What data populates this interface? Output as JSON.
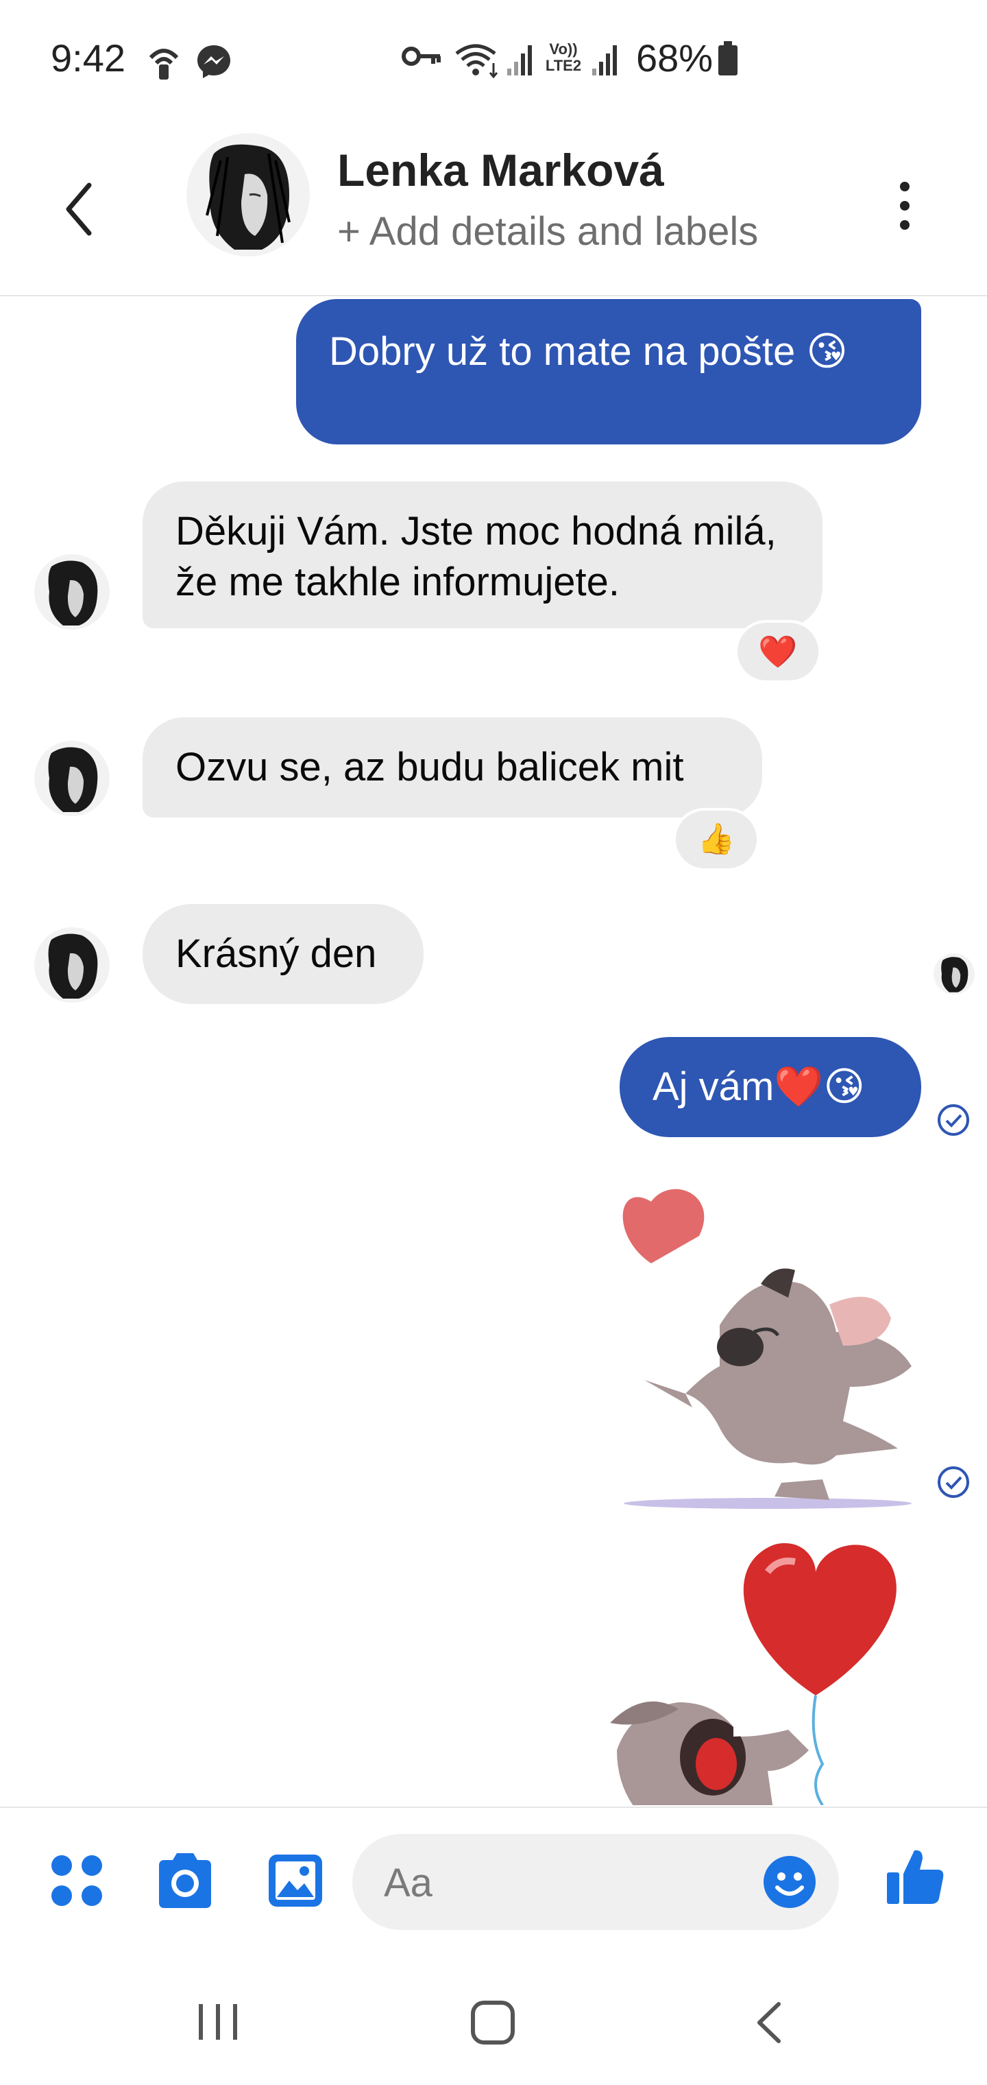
{
  "status_bar": {
    "time": "9:42",
    "battery": "68%",
    "icons": [
      "hotspot-icon",
      "messenger-icon",
      "vpn-key-icon",
      "wifi-icon",
      "signal-icon",
      "volte-icon",
      "signal-icon",
      "battery-icon"
    ],
    "volte_label": "Vo)) LTE2"
  },
  "header": {
    "name": "Lenka Marková",
    "subtitle": "+ Add details and labels",
    "icons": [
      "back-arrow-icon",
      "more-vert-icon"
    ]
  },
  "messages": [
    {
      "from": "me",
      "text": "Dobry už to mate na pošte 😘"
    },
    {
      "from": "them",
      "text": "Děkuji Vám. Jste moc hodná milá, že me takhle informujete.",
      "reaction": "❤️"
    },
    {
      "from": "them",
      "text": "Ozvu se, az budu balicek mit",
      "reaction": "👍"
    },
    {
      "from": "them",
      "text": "Krásný den"
    },
    {
      "from": "me",
      "text": "Aj vám❤️😘"
    },
    {
      "from": "me",
      "sticker": "dog-kiss-heart-sticker"
    },
    {
      "from": "me",
      "sticker": "dog-heart-balloon-sticker"
    }
  ],
  "composer": {
    "placeholder": "Aa",
    "icons": [
      "apps-icon",
      "camera-icon",
      "gallery-icon",
      "emoji-icon",
      "like-icon"
    ],
    "accent": "#1b74e4"
  },
  "navbar": {
    "icons": [
      "recents-icon",
      "home-icon",
      "back-icon"
    ]
  },
  "colors": {
    "outgoing_bubble": "#2e56b3",
    "incoming_bubble": "#ebebeb",
    "accent": "#1b74e4"
  }
}
